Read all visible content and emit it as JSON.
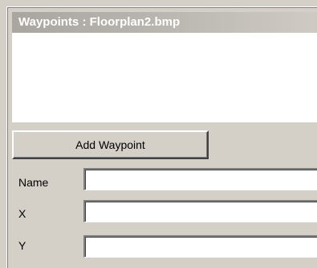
{
  "panel": {
    "title": "Waypoints : Floorplan2.bmp"
  },
  "waypoint_list": {
    "items": []
  },
  "buttons": {
    "add_waypoint": "Add Waypoint"
  },
  "fields": {
    "name": {
      "label": "Name",
      "value": ""
    },
    "x": {
      "label": "X",
      "value": ""
    },
    "y": {
      "label": "Y",
      "value": ""
    }
  }
}
